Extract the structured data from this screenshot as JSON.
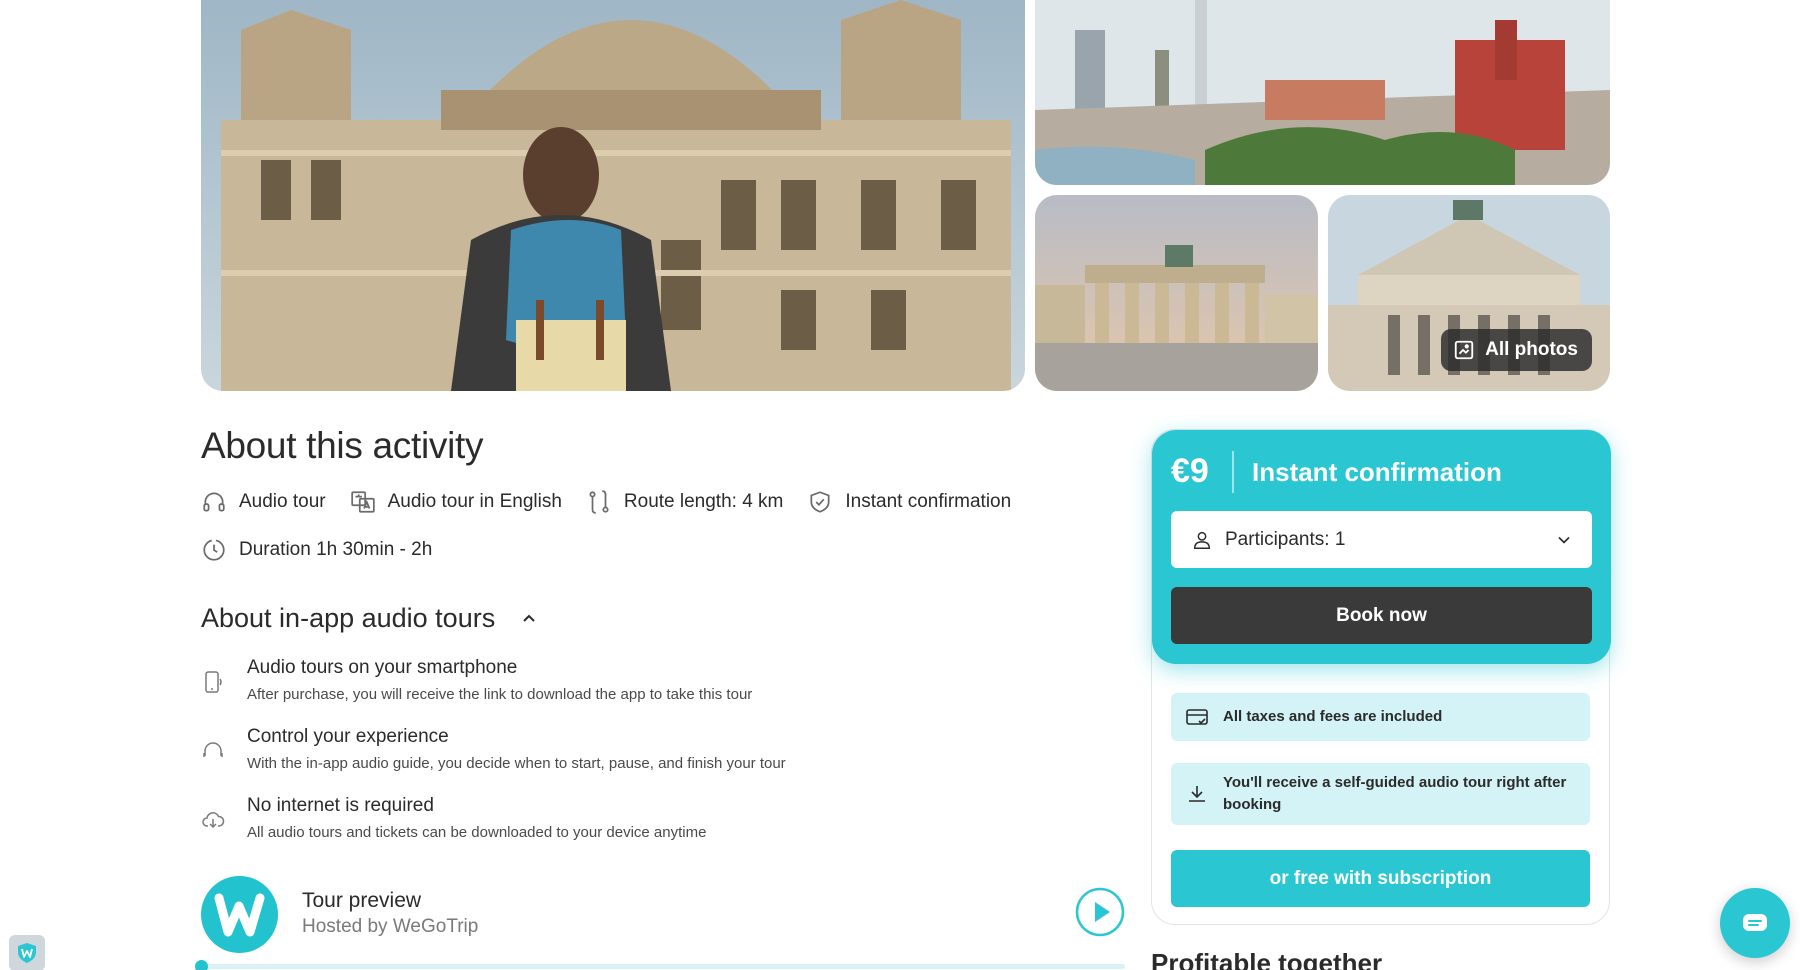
{
  "gallery": {
    "all_photos_label": "All photos"
  },
  "about": {
    "title": "About this activity",
    "features": [
      {
        "icon": "headphones-icon",
        "label": "Audio tour"
      },
      {
        "icon": "translate-icon",
        "label": "Audio tour in English"
      },
      {
        "icon": "route-icon",
        "label": "Route length: 4 km"
      },
      {
        "icon": "shield-check-icon",
        "label": "Instant confirmation"
      },
      {
        "icon": "clock-icon",
        "label": "Duration 1h 30min - 2h"
      }
    ]
  },
  "audio_tours": {
    "title": "About in-app audio tours",
    "items": [
      {
        "icon": "smartphone-icon",
        "title": "Audio tours on your smartphone",
        "desc": "After purchase, you will receive the link to download the app to take this tour"
      },
      {
        "icon": "headset-icon",
        "title": "Control your experience",
        "desc": "With the in-app audio guide, you decide when to start, pause, and finish your tour"
      },
      {
        "icon": "cloud-download-icon",
        "title": "No internet is required",
        "desc": "All audio tours and tickets can be downloaded to your device anytime"
      }
    ]
  },
  "preview": {
    "title": "Tour preview",
    "host": "Hosted by WeGoTrip",
    "progress": 0
  },
  "booking": {
    "price": "€9",
    "confirmation": "Instant confirmation",
    "participants": "Participants: 1",
    "book_label": "Book now",
    "info_taxes": "All taxes and fees are included",
    "info_audio": "You'll receive a self-guided audio tour right after booking",
    "subscription_label": "or free with subscription"
  },
  "profitable": {
    "title": "Profitable together"
  },
  "colors": {
    "accent": "#2ac6d2",
    "dark_button": "#3a3a3a",
    "info_bg": "#d4f3f6"
  }
}
